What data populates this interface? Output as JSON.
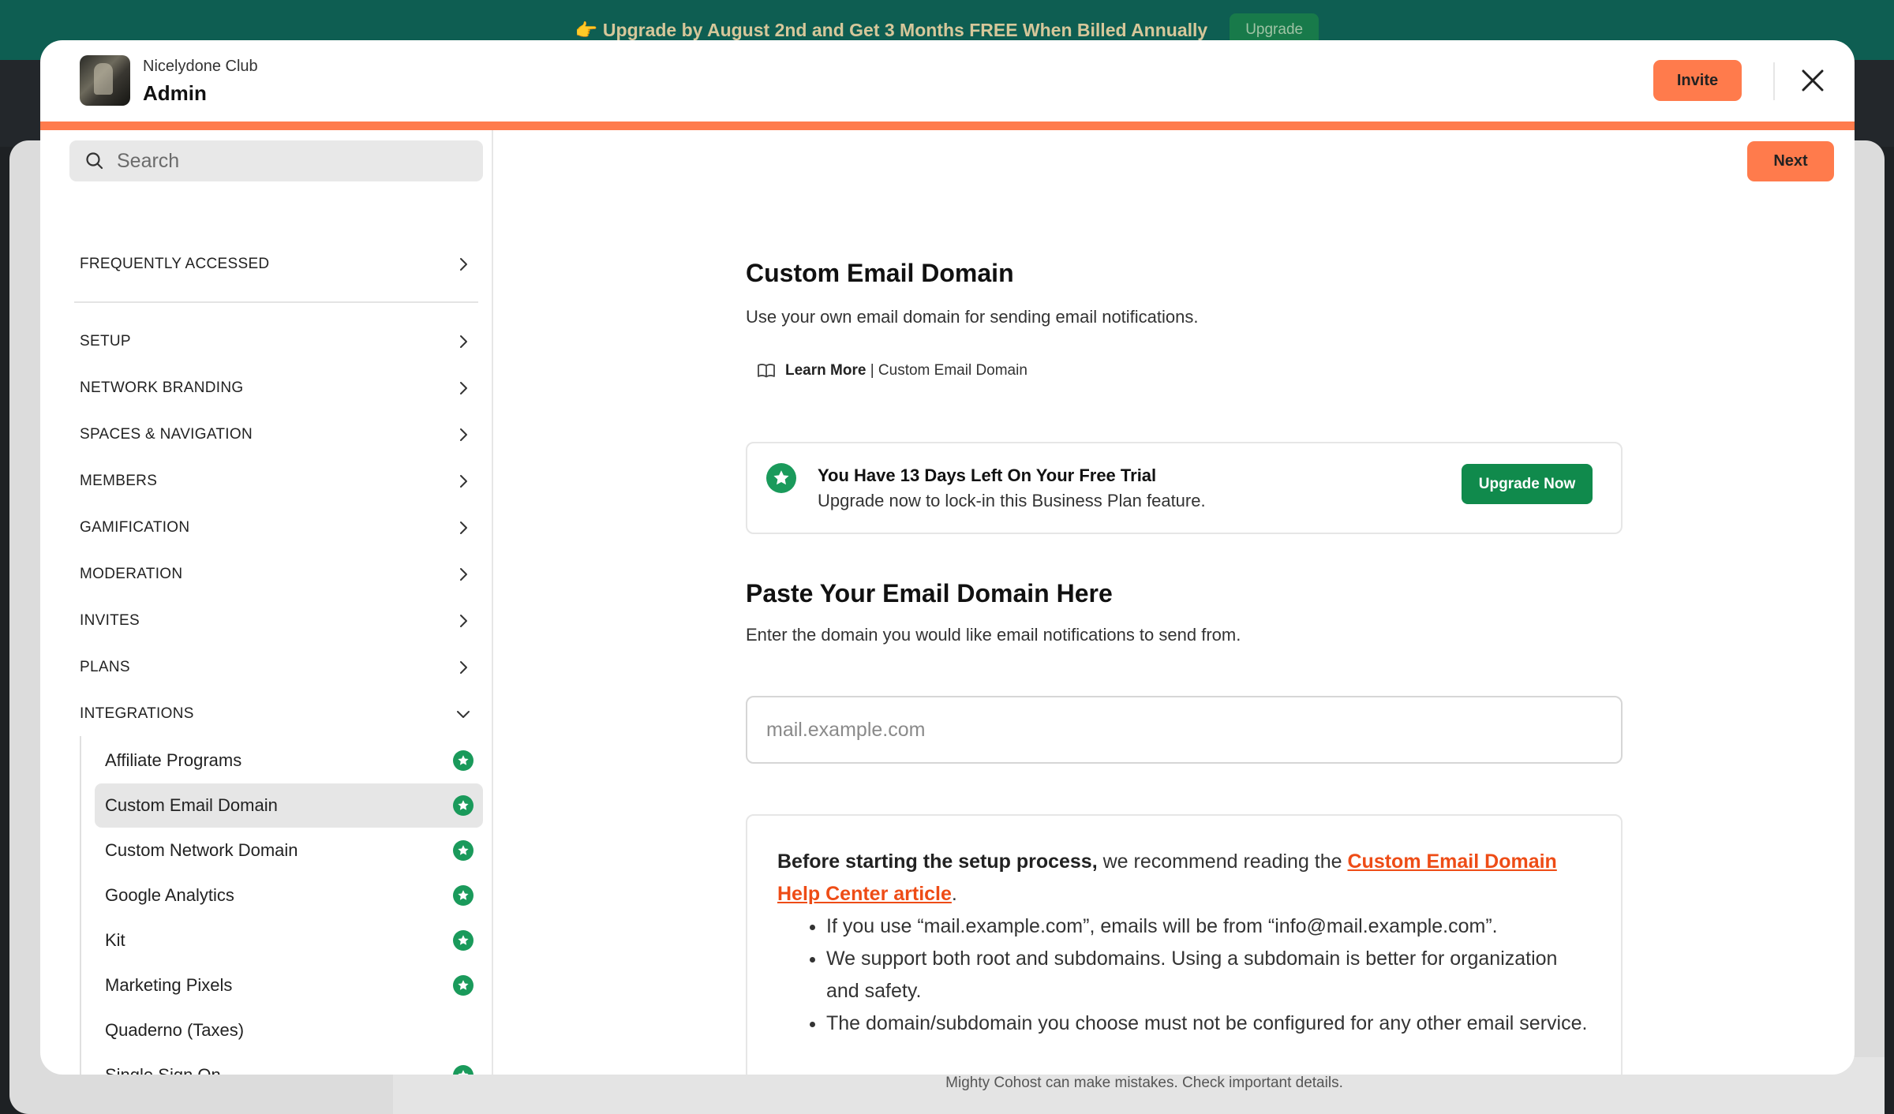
{
  "banner": {
    "text": "👉 Upgrade by August 2nd and Get 3 Months FREE When Billed Annually",
    "button_label": "Upgrade"
  },
  "footer_note": "Mighty Cohost can make mistakes. Check important details.",
  "header": {
    "org_name": "Nicelydone Club",
    "page_name": "Admin",
    "invite_label": "Invite",
    "close_icon": "close-icon"
  },
  "sidebar": {
    "search_placeholder": "Search",
    "sections": [
      {
        "label": "FREQUENTLY ACCESSED"
      },
      {
        "label": "SETUP"
      },
      {
        "label": "NETWORK BRANDING"
      },
      {
        "label": "SPACES & NAVIGATION"
      },
      {
        "label": "MEMBERS"
      },
      {
        "label": "GAMIFICATION"
      },
      {
        "label": "MODERATION"
      },
      {
        "label": "INVITES"
      },
      {
        "label": "PLANS"
      },
      {
        "label": "INTEGRATIONS"
      }
    ],
    "integrations": [
      {
        "label": "Affiliate Programs",
        "premium": true
      },
      {
        "label": "Custom Email Domain",
        "premium": true,
        "active": true
      },
      {
        "label": "Custom Network Domain",
        "premium": true
      },
      {
        "label": "Google Analytics",
        "premium": true
      },
      {
        "label": "Kit",
        "premium": true
      },
      {
        "label": "Marketing Pixels",
        "premium": true
      },
      {
        "label": "Quaderno (Taxes)",
        "premium": false
      },
      {
        "label": "Single Sign On",
        "premium": true
      }
    ]
  },
  "content": {
    "next_label": "Next",
    "title": "Custom Email Domain",
    "subtitle": "Use your own email domain for sending email notifications.",
    "learn_more_bold": "Learn More",
    "learn_more_rest": " | Custom Email Domain",
    "trial": {
      "title": "You Have 13 Days Left On Your Free Trial",
      "text": "Upgrade now to lock-in this Business Plan feature.",
      "button_label": "Upgrade Now"
    },
    "paste_title": "Paste Your Email Domain Here",
    "paste_subtitle": "Enter the domain you would like email notifications to send from.",
    "domain_placeholder": "mail.example.com",
    "domain_value": "",
    "info": {
      "intro_bold": "Before starting the setup process,",
      "intro_text": " we recommend reading the ",
      "link_text": "Custom Email Domain Help Center article",
      "intro_end": ".",
      "bullets": [
        "If you use “mail.example.com”, emails will be from “info@mail.example.com”.",
        "We support both root and subdomains. Using a subdomain is better for organization and safety.",
        "The domain/subdomain you choose must not be configured for any other email service."
      ]
    }
  },
  "colors": {
    "accent": "#ff7b4c",
    "premium_green": "#1a9a5b",
    "upgrade_green": "#108a4c",
    "banner_bg": "#0e5e52",
    "link": "#ee4c16"
  }
}
